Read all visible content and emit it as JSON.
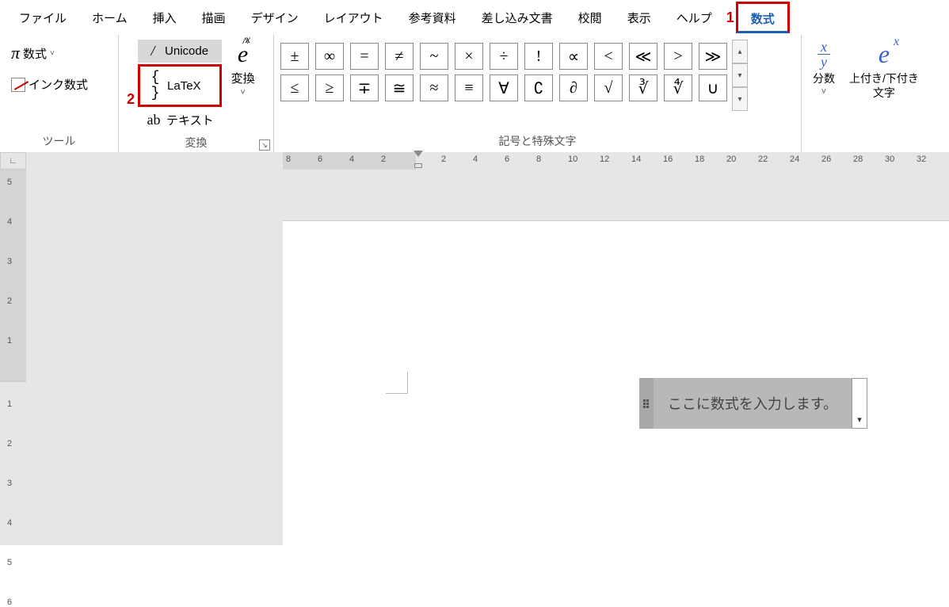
{
  "menubar": {
    "items": [
      "ファイル",
      "ホーム",
      "挿入",
      "描画",
      "デザイン",
      "レイアウト",
      "参考資料",
      "差し込み文書",
      "校閲",
      "表示",
      "ヘルプ",
      "数式"
    ],
    "active_index": 11
  },
  "annotations": {
    "one": "1",
    "two": "2"
  },
  "ribbon": {
    "tools": {
      "equation_label": "数式",
      "ink_label": "インク数式",
      "group_label": "ツール"
    },
    "convert": {
      "unicode": "Unicode",
      "latex": "LaTeX",
      "text": "テキスト",
      "ehat_label": "変換",
      "group_label": "変換"
    },
    "symbols": {
      "row1": [
        "±",
        "∞",
        "=",
        "≠",
        "~",
        "×",
        "÷",
        "!",
        "∝",
        "<",
        "≪",
        ">",
        "≫"
      ],
      "row2": [
        "≤",
        "≥",
        "∓",
        "≅",
        "≈",
        "≡",
        "∀",
        "∁",
        "∂",
        "√",
        "∛",
        "∜",
        "∪"
      ],
      "group_label": "記号と特殊文字"
    },
    "structs": {
      "fraction_label": "分数",
      "script_label": "上付き/下付き\n文字"
    }
  },
  "ruler_h": {
    "neg": [
      "8",
      "6",
      "4",
      "2"
    ],
    "pos": [
      "2",
      "4",
      "6",
      "8",
      "10",
      "12",
      "14",
      "16",
      "18",
      "20",
      "22",
      "24",
      "26",
      "28",
      "30",
      "32"
    ]
  },
  "ruler_v": {
    "neg": [
      "5",
      "4",
      "3",
      "2",
      "1"
    ],
    "pos": [
      "1",
      "2",
      "3",
      "4",
      "5",
      "6"
    ]
  },
  "equation_placeholder": "ここに数式を入力します。"
}
